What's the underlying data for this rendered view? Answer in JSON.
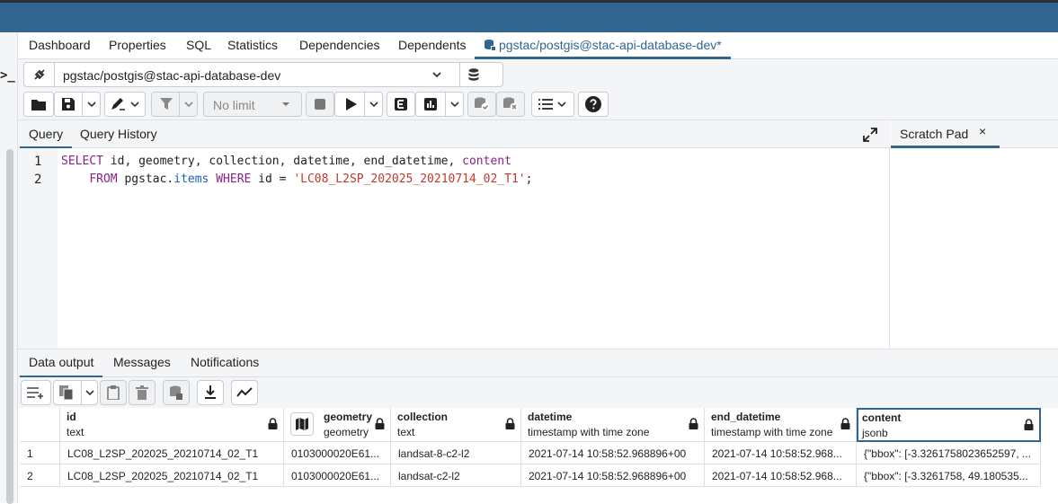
{
  "tabs": {
    "items": [
      "Dashboard",
      "Properties",
      "SQL",
      "Statistics",
      "Dependencies",
      "Dependents"
    ],
    "active": "pgstac/postgis@stac-api-database-dev*"
  },
  "connection": {
    "label": "pgstac/postgis@stac-api-database-dev"
  },
  "toolbar": {
    "limit": "No limit"
  },
  "query_tabs": {
    "query": "Query",
    "history": "Query History"
  },
  "scratch": {
    "title": "Scratch Pad",
    "close": "×"
  },
  "editor": {
    "line1_no": "1",
    "line2_no": "2",
    "l1_select": "SELECT",
    "l1_cols": " id, geometry, collection, datetime, end_datetime, ",
    "l1_content": "content",
    "l2_indent": "    ",
    "l2_from": "FROM",
    "l2_schema": " pgstac.",
    "l2_items": "items",
    "l2_where": " WHERE",
    "l2_cond": " id = ",
    "l2_str": "'LC08_L2SP_202025_20210714_02_T1'",
    "l2_end": ";"
  },
  "output_tabs": {
    "data": "Data output",
    "messages": "Messages",
    "notifications": "Notifications"
  },
  "columns": [
    {
      "name": "id",
      "type": "text"
    },
    {
      "name": "geometry",
      "type": "geometry"
    },
    {
      "name": "collection",
      "type": "text"
    },
    {
      "name": "datetime",
      "type": "timestamp with time zone"
    },
    {
      "name": "end_datetime",
      "type": "timestamp with time zone"
    },
    {
      "name": "content",
      "type": "jsonb"
    }
  ],
  "rows": [
    {
      "num": "1",
      "id": "LC08_L2SP_202025_20210714_02_T1",
      "geometry": "0103000020E61...",
      "collection": "landsat-8-c2-l2",
      "datetime": "2021-07-14 10:58:52.968896+00",
      "end_datetime": "2021-07-14 10:58:52.968...",
      "content": "{\"bbox\": [-3.3261758023652597, ..."
    },
    {
      "num": "2",
      "id": "LC08_L2SP_202025_20210714_02_T1",
      "geometry": "0103000020E61...",
      "collection": "landsat-c2-l2",
      "datetime": "2021-07-14 10:58:52.968896+00",
      "end_datetime": "2021-07-14 10:58:52.968...",
      "content": "{\"bbox\": [-3.3261758, 49.180535..."
    }
  ],
  "colors": {
    "accent": "#326690",
    "keyword": "#8a1f8a",
    "string": "#c0392b"
  }
}
